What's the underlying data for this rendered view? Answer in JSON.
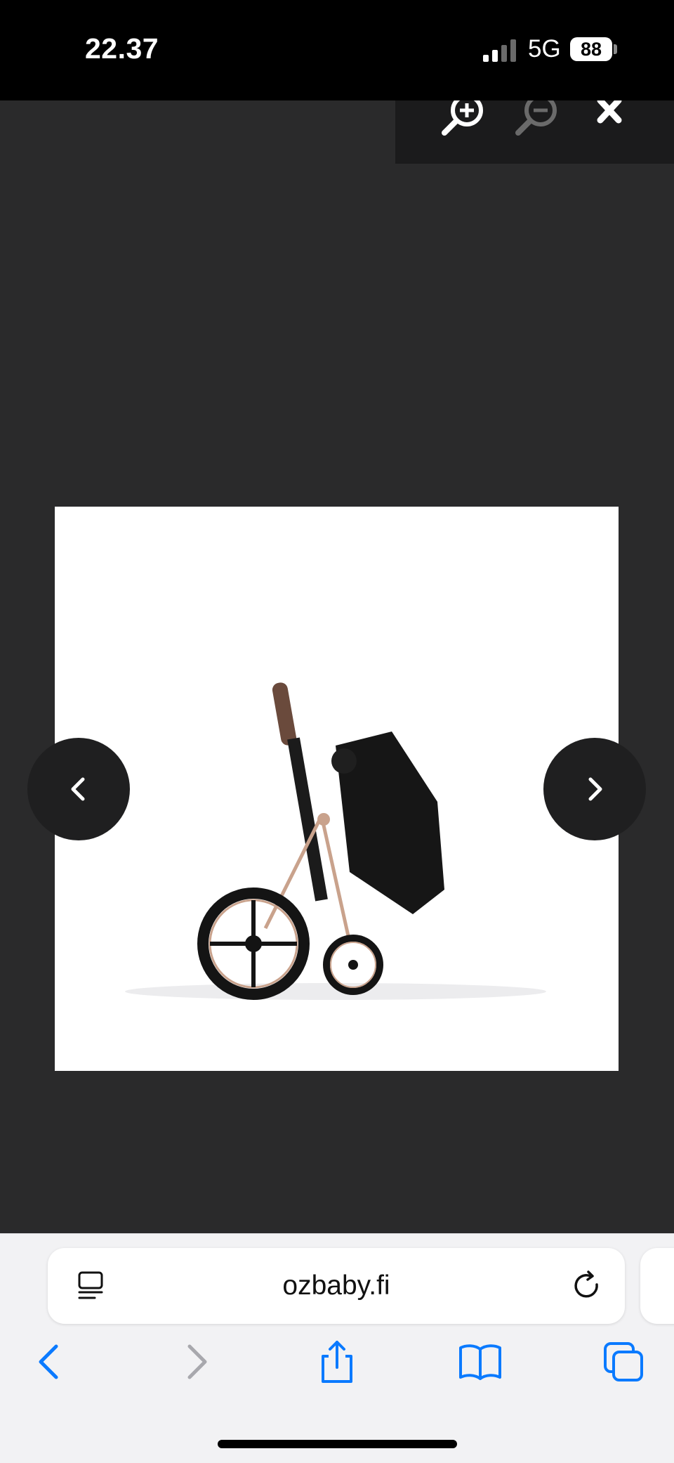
{
  "status_bar": {
    "time": "22.37",
    "network": "5G",
    "battery": "88"
  },
  "toolbar": {
    "zoom_in": "zoom-in-icon",
    "zoom_out": "zoom-out-icon",
    "close": "close-icon"
  },
  "gallery": {
    "image_alt": "Stroller"
  },
  "browser": {
    "url": "ozbaby.fi"
  },
  "colors": {
    "accent": "#0a7aff",
    "viewer_bg": "#2a2a2b",
    "toolbar_bg": "#1b1b1c"
  }
}
